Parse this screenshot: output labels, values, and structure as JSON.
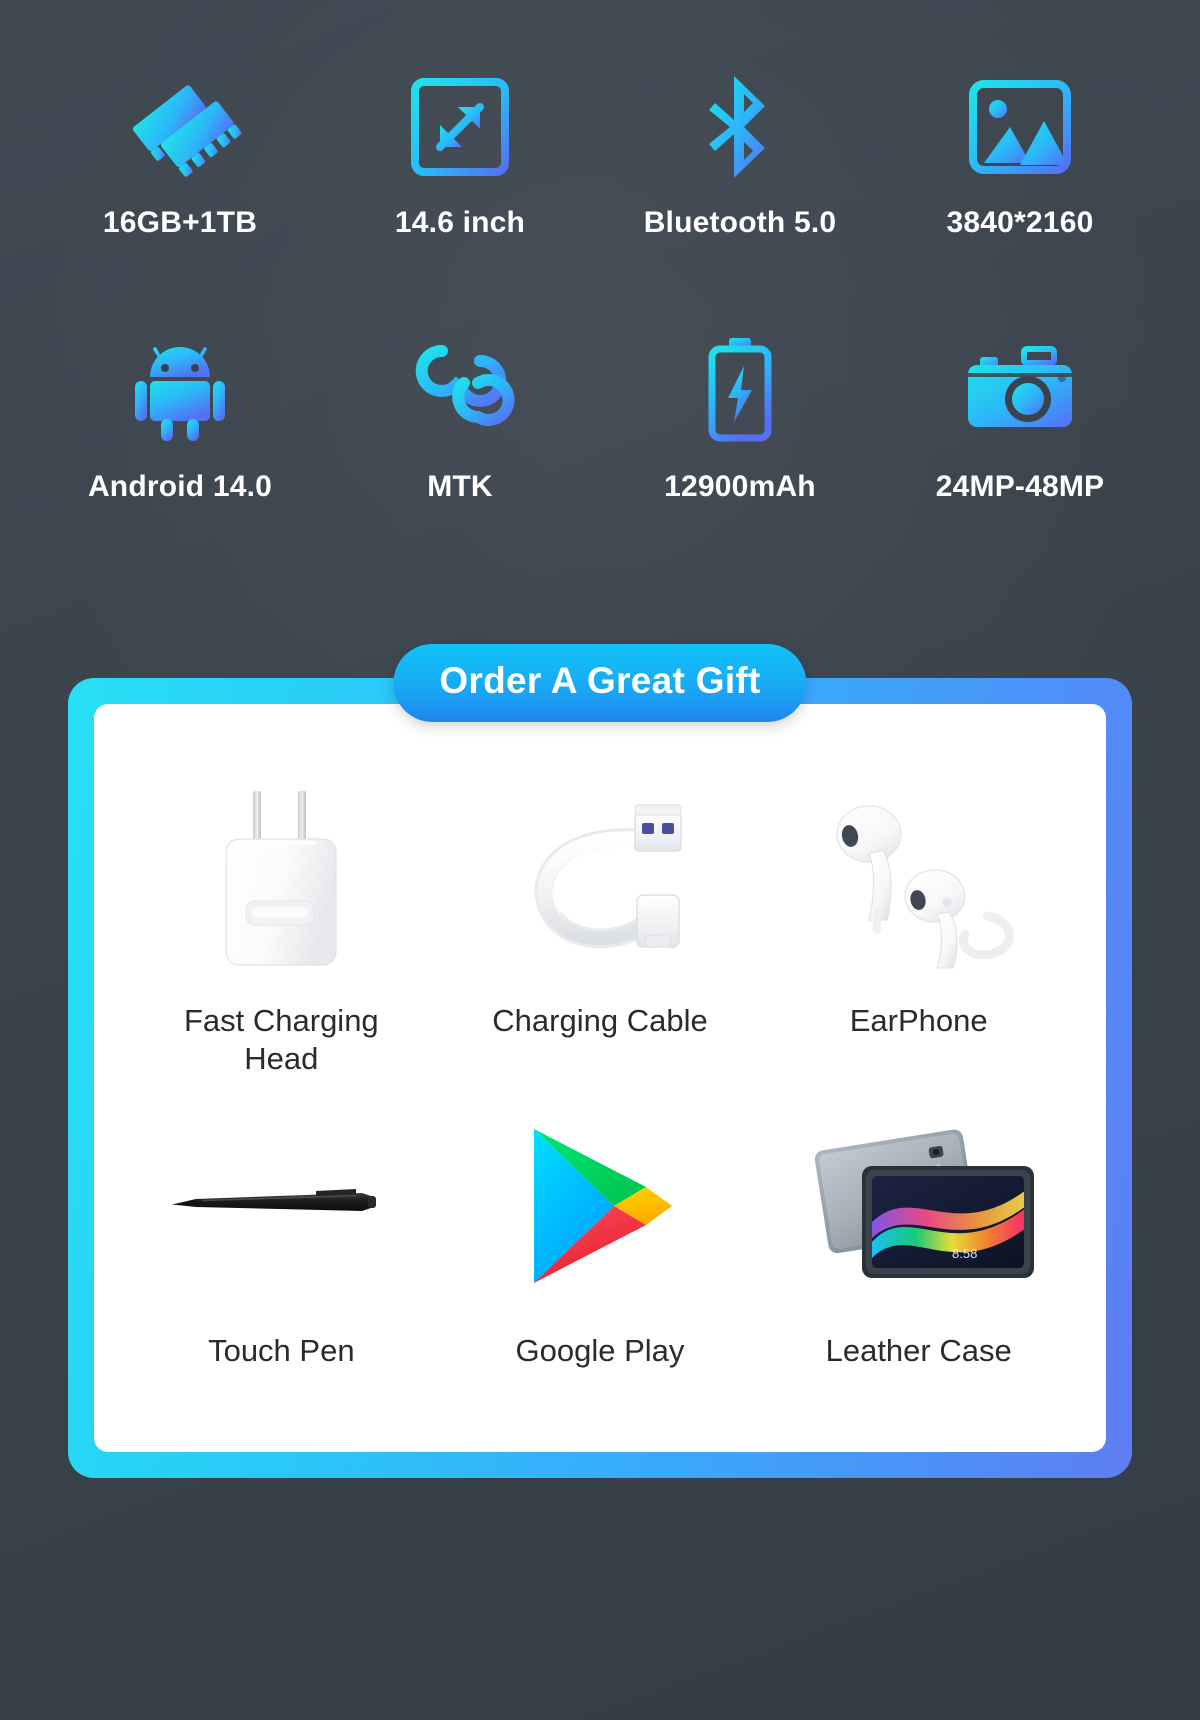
{
  "specs": {
    "items": [
      {
        "icon": "memory-ram-icon",
        "label": "16GB+1TB"
      },
      {
        "icon": "screen-expand-icon",
        "label": "14.6 inch"
      },
      {
        "icon": "bluetooth-icon",
        "label": "Bluetooth 5.0"
      },
      {
        "icon": "image-resolution-icon",
        "label": "3840*2160"
      },
      {
        "icon": "android-robot-icon",
        "label": "Android 14.0"
      },
      {
        "icon": "chipset-infinity-icon",
        "label": "MTK"
      },
      {
        "icon": "battery-charge-icon",
        "label": "12900mAh"
      },
      {
        "icon": "camera-icon",
        "label": "24MP-48MP"
      }
    ]
  },
  "gift": {
    "badge_label": "Order A Great Gift",
    "items": [
      {
        "icon": "charger-head-image",
        "label": "Fast Charging Head"
      },
      {
        "icon": "usb-cable-image",
        "label": "Charging Cable"
      },
      {
        "icon": "earphone-image",
        "label": "EarPhone"
      },
      {
        "icon": "stylus-pen-image",
        "label": "Touch Pen"
      },
      {
        "icon": "google-play-logo",
        "label": "Google Play"
      },
      {
        "icon": "tablet-leather-case-image",
        "label": "Leather Case"
      }
    ]
  },
  "colors": {
    "background": "#3a434d",
    "icon_gradient_start": "#22dcf0",
    "icon_gradient_end": "#5570f5",
    "badge_gradient_start": "#11c3f7",
    "badge_gradient_end": "#1f85ee",
    "card_border_start": "#27e0f5",
    "card_border_end": "#5f7df3",
    "spec_label_color": "#ffffff",
    "gift_label_color": "#2b2b2b",
    "card_background": "#ffffff"
  }
}
